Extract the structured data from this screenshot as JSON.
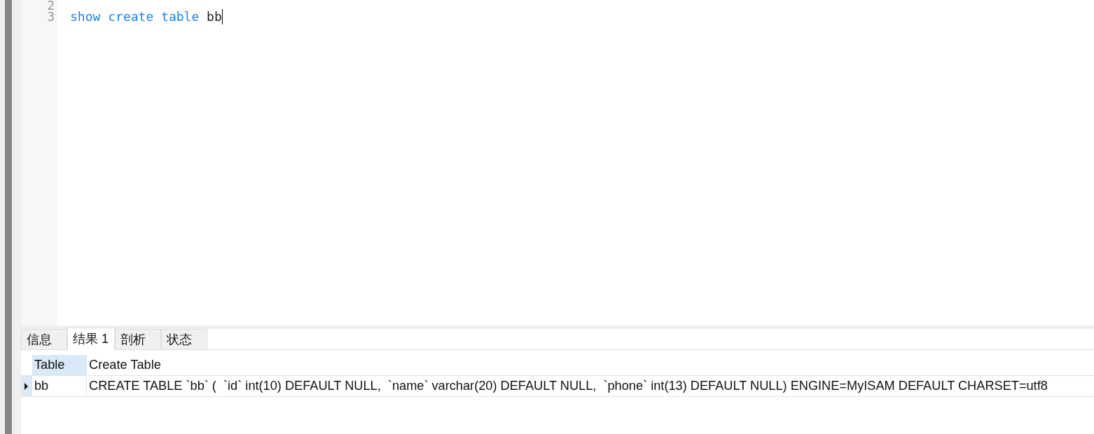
{
  "editor": {
    "lines": [
      {
        "number": "2",
        "caret": false
      },
      {
        "number": "3",
        "caret": true,
        "tokens": [
          {
            "kind": "keyword",
            "text": "show"
          },
          {
            "kind": "keyword",
            "text": "create"
          },
          {
            "kind": "keyword",
            "text": "table"
          },
          {
            "kind": "identifier",
            "text": "bb"
          }
        ]
      }
    ]
  },
  "tabs": [
    {
      "label": "信息",
      "selected": false
    },
    {
      "label": "结果 1",
      "selected": true
    },
    {
      "label": "剖析",
      "selected": false
    },
    {
      "label": "状态",
      "selected": false
    }
  ],
  "grid": {
    "columns": [
      {
        "label": "Table",
        "selected": true
      },
      {
        "label": "Create Table",
        "selected": false
      }
    ],
    "rows": [
      {
        "current": true,
        "cells": [
          "bb",
          "CREATE TABLE `bb` (  `id` int(10) DEFAULT NULL,  `name` varchar(20) DEFAULT NULL,  `phone` int(13) DEFAULT NULL) ENGINE=MyISAM DEFAULT CHARSET=utf8"
        ]
      }
    ]
  }
}
